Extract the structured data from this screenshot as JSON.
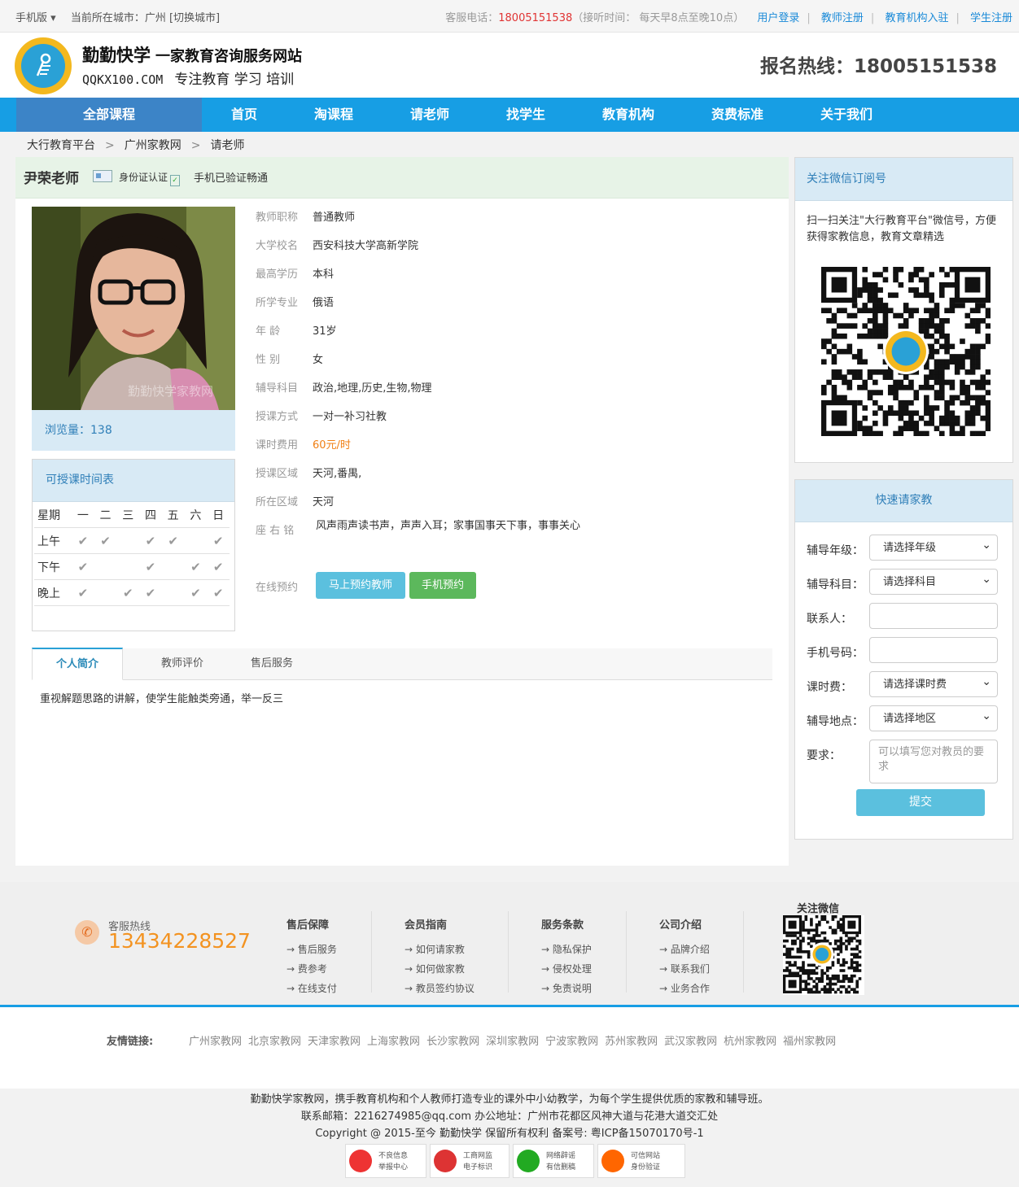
{
  "topbar": {
    "mobile": "手机版 ▾",
    "city": "当前所在城市：广州 [切换城市]",
    "service_label": "客服电话：",
    "service_phone": "18005151538",
    "service_hours": "（接听时间：  每天早8点至晚10点）",
    "links": [
      "用户登录",
      "教师注册",
      "教育机构入驻",
      "学生注册"
    ]
  },
  "header": {
    "brand": "勤勤快学",
    "brand_sub": "一家教育咨询服务网站",
    "url": "QQKX100.COM",
    "slogan": "专注教育  学习  培训",
    "hotline": "报名热线：18005151538"
  },
  "nav": [
    "全部课程",
    "首页",
    "淘课程",
    "请老师",
    "找学生",
    "教育机构",
    "资费标准",
    "关于我们"
  ],
  "breadcrumb": [
    "大行教育平台",
    "广州家教网",
    "请老师"
  ],
  "teacher": {
    "name": "尹荣老师",
    "id_verified": "身份证认证",
    "phone_verified": "手机已验证畅通",
    "views": "浏览量：138",
    "photo_watermark": "勤勤快学家教网",
    "fields": [
      {
        "k": "教师职称",
        "v": "普通教师"
      },
      {
        "k": "大学校名",
        "v": "西安科技大学高新学院"
      },
      {
        "k": "最高学历",
        "v": "本科"
      },
      {
        "k": "所学专业",
        "v": "俄语"
      },
      {
        "k": "年 龄",
        "v": "31岁"
      },
      {
        "k": "性 别",
        "v": "女"
      },
      {
        "k": "辅导科目",
        "v": "政治,地理,历史,生物,物理"
      },
      {
        "k": "授课方式",
        "v": "一对一补习社教"
      },
      {
        "k": "课时费用",
        "v": "60元/时"
      },
      {
        "k": "授课区域",
        "v": "天河,番禺,"
      },
      {
        "k": "所在区域",
        "v": "天河"
      }
    ],
    "motto_label": "座 右 铭",
    "motto": "风声雨声读书声，声声入耳；家事国事天下事，事事关心",
    "booking_label": "在线预约",
    "book_button": "马上预约教师",
    "phone_button": "手机预约"
  },
  "schedule": {
    "title": "可授课时间表",
    "header": [
      "星期",
      "一",
      "二",
      "三",
      "四",
      "五",
      "六",
      "日"
    ],
    "rows": [
      {
        "label": "上午",
        "days": [
          1,
          1,
          0,
          1,
          1,
          0,
          1
        ]
      },
      {
        "label": "下午",
        "days": [
          1,
          0,
          0,
          1,
          0,
          1,
          1
        ]
      },
      {
        "label": "晚上",
        "days": [
          1,
          0,
          1,
          1,
          0,
          1,
          1
        ]
      }
    ]
  },
  "tabs": [
    "个人简介",
    "教师评价",
    "售后服务"
  ],
  "intro": "重视解题思路的讲解，使学生能触类旁通，举一反三",
  "wechat": {
    "title": "关注微信订阅号",
    "text": "扫一扫关注\"大行教育平台\"微信号，方便获得家教信息，教育文章精选"
  },
  "quick": {
    "title": "快速请家教",
    "grade_label": "辅导年级：",
    "grade": "请选择年级",
    "subject_label": "辅导科目：",
    "subject": "请选择科目",
    "contact_label": "联系人：",
    "phone_label": "手机号码：",
    "fee_label": "课时费：",
    "fee": "请选择课时费",
    "place_label": "辅导地点：",
    "place": "请选择地区",
    "req_label": "要求：",
    "req_placeholder": "可以填写您对教员的要求",
    "submit": "提交"
  },
  "footer": {
    "hotline_label": "客服热线",
    "hotline": "13434228527",
    "cols": [
      {
        "title": "售后保障",
        "items": [
          "→ 售后服务",
          "→ 费参考",
          "→ 在线支付"
        ]
      },
      {
        "title": "会员指南",
        "items": [
          "→ 如何请家教",
          "→ 如何做家教",
          "→ 教员签约协议"
        ]
      },
      {
        "title": "服务条款",
        "items": [
          "→ 隐私保护",
          "→ 侵权处理",
          "→ 免责说明"
        ]
      },
      {
        "title": "公司介绍",
        "items": [
          "→ 品牌介绍",
          "→ 联系我们",
          "→ 业务合作"
        ]
      }
    ],
    "wechat": "关注微信",
    "links_label": "友情链接:",
    "links": [
      "广州家教网",
      "北京家教网",
      "天津家教网",
      "上海家教网",
      "长沙家教网",
      "深圳家教网",
      "宁波家教网",
      "苏州家教网",
      "武汉家教网",
      "杭州家教网",
      "福州家教网"
    ],
    "copy1": "勤勤快学家教网，携手教育机构和个人教师打造专业的课外中小幼教学，为每个学生提供优质的家教和辅导班。",
    "copy2": "联系邮箱：2216274985@qq.com      办公地址：广州市花都区风神大道与花港大道交汇处",
    "copy3": "Copyright @ 2015-至今 勤勤快学 保留所有权利 备案号: 粤ICP备15070170号-1",
    "badges": [
      [
        "不良信息",
        "举报中心"
      ],
      [
        "工商网监",
        "电子标识"
      ],
      [
        "网络辟谣",
        "有信删稿"
      ],
      [
        "可信网站",
        "身份验证"
      ]
    ]
  }
}
